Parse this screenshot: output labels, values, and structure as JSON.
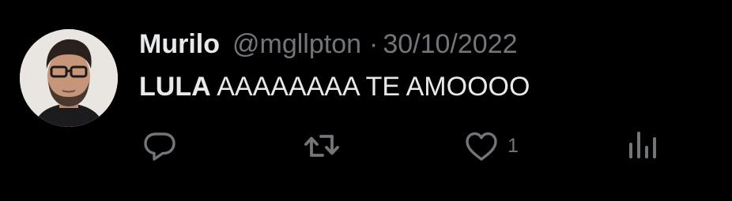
{
  "tweet": {
    "author_name": "Murilo",
    "handle": "@mgllpton",
    "separator": "·",
    "date": "30/10/2022",
    "text_bold": "LULA",
    "text_rest": " AAAAAAAA TE AMOOOO"
  },
  "actions": {
    "like_count": "1"
  },
  "colors": {
    "background": "#000000",
    "primary_text": "#e7e9ea",
    "secondary_text": "#71767b"
  },
  "icons": [
    "reply-icon",
    "retweet-icon",
    "like-icon",
    "views-icon"
  ]
}
